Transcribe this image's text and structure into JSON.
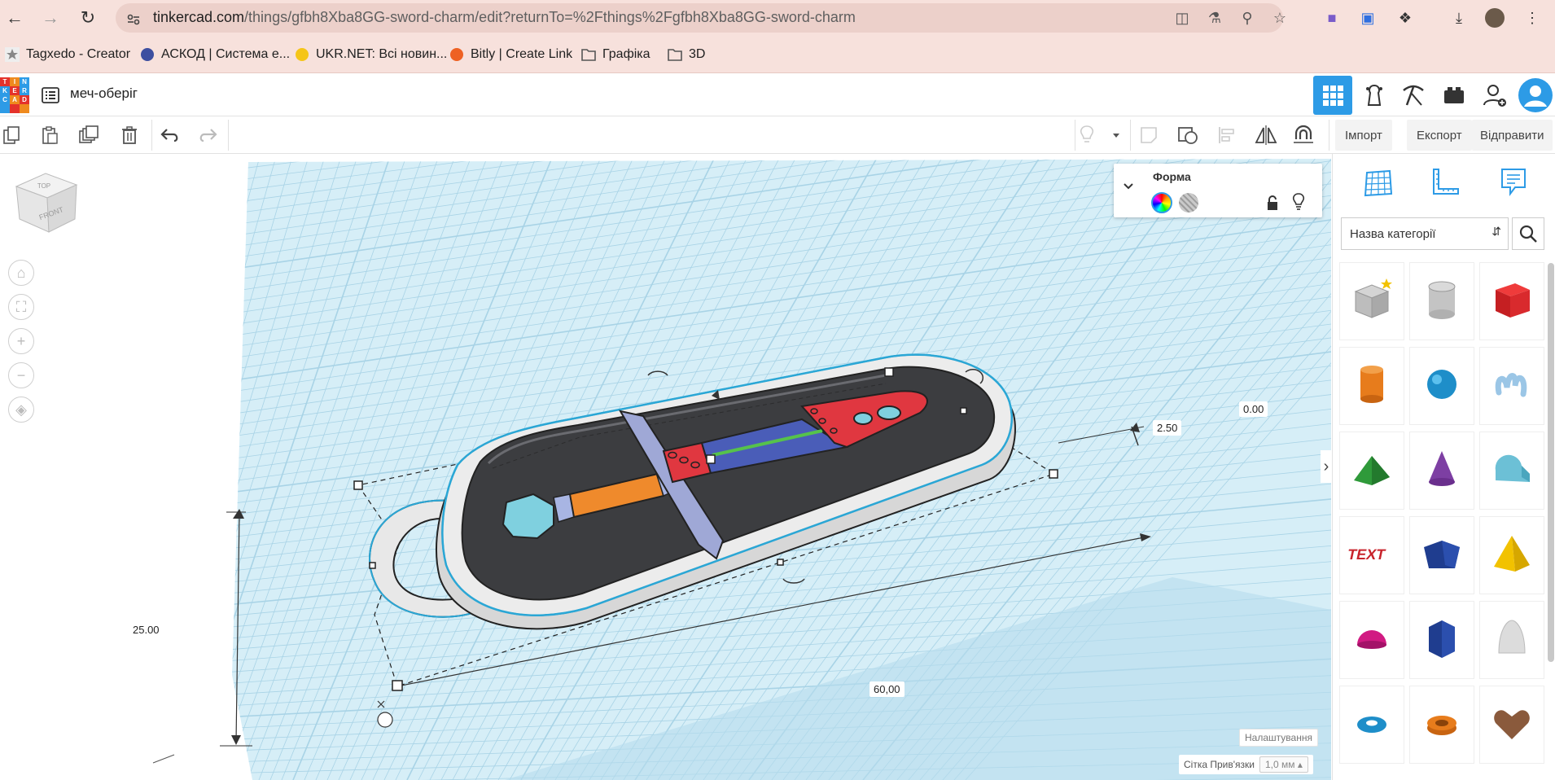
{
  "browser": {
    "url_host": "tinkercad.com",
    "url_rest": "/things/gfbh8Xba8GG-sword-charm/edit?returnTo=%2Fthings%2Fgfbh8Xba8GG-sword-charm",
    "bookmarks": [
      {
        "label": "Tagxedo - Creator",
        "icon": "star-icon",
        "color": "#555555"
      },
      {
        "label": "АСКОД | Система е...",
        "icon": "askod-icon",
        "color": "#3d4fa0"
      },
      {
        "label": "UKR.NET: Всі новин...",
        "icon": "ukrnet-icon",
        "color": "#f5c518"
      },
      {
        "label": "Bitly | Create Link",
        "icon": "bitly-icon",
        "color": "#ee6123"
      },
      {
        "label": "Графіка",
        "icon": "folder-icon",
        "color": "#555555"
      },
      {
        "label": "3D",
        "icon": "folder-icon",
        "color": "#555555"
      }
    ]
  },
  "app": {
    "design_name": "меч-оберіг",
    "logo_letters": [
      "T",
      "I",
      "N",
      "K",
      "E",
      "R",
      "C",
      "A",
      "D",
      "",
      "",
      ""
    ],
    "accent": "#2d9be6"
  },
  "toolbar": {
    "import_label": "Імпорт",
    "export_label": "Експорт",
    "send_label": "Відправити"
  },
  "view_cube": {
    "top_label": "TOP",
    "front_label": "FRONT"
  },
  "shape_panel": {
    "title": "Форма"
  },
  "dimensions": {
    "height": "25.00",
    "length": "60,00",
    "elevation": "2.50",
    "offset": "0.00"
  },
  "workplane": {
    "settings_label": "Налаштування",
    "snap_label": "Сітка Прив'язки",
    "snap_value": "1,0 мм"
  },
  "right_panel": {
    "category_placeholder": "Назва категорії",
    "shapes": [
      "box-hole-icon",
      "cylinder-hole-icon",
      "box-icon",
      "cylinder-icon",
      "sphere-icon",
      "scribble-icon",
      "roof-icon",
      "cone-icon",
      "round-roof-icon",
      "text-icon",
      "prism-icon",
      "pyramid-icon",
      "half-sphere-icon",
      "polygon-icon",
      "paraboloid-icon",
      "torus-icon",
      "tube-icon",
      "heart-icon"
    ]
  }
}
